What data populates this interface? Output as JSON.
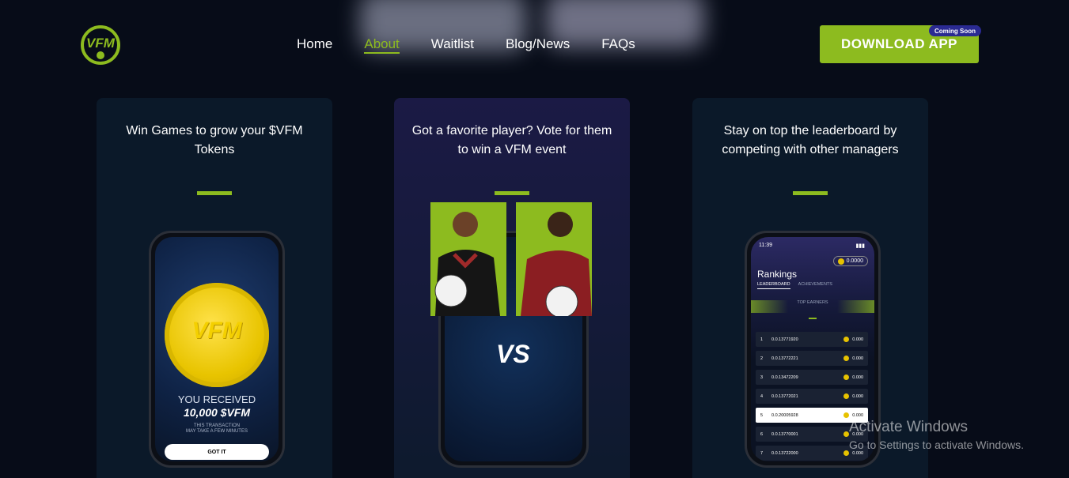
{
  "logo": {
    "alt": "VFM",
    "color": "#8dbb1f"
  },
  "nav": {
    "items": [
      {
        "label": "Home"
      },
      {
        "label": "About"
      },
      {
        "label": "Waitlist"
      },
      {
        "label": "Blog/News"
      },
      {
        "label": "FAQs"
      }
    ],
    "active": "About"
  },
  "download": {
    "label": "DOWNLOAD APP",
    "badge": "Coming Soon"
  },
  "cards": [
    {
      "text": "Win Games to grow your $VFM Tokens"
    },
    {
      "text": "Got a favorite player? Vote for them to win a VFM event"
    },
    {
      "text": "Stay on top the leaderboard by competing with other managers"
    }
  ],
  "phone1": {
    "coin_label": "VFM",
    "received": "YOU RECEIVED",
    "amount": "10,000 $VFM",
    "note_line1": "THIS TRANSACTION",
    "note_line2": "MAY TAKE A FEW MINUTES",
    "button": "GOT IT"
  },
  "phone2": {
    "vs": "VS"
  },
  "phone3": {
    "time": "11:39",
    "balance": "0.0000",
    "title": "Rankings",
    "tab_leaderboard": "LEADERBOARD",
    "tab_achievements": "ACHIEVEMENTS",
    "top_earners": "TOP EARNERS",
    "rows": [
      {
        "rank": "1",
        "addr": "0.0.13771920",
        "value": "0.000"
      },
      {
        "rank": "2",
        "addr": "0.0.13772221",
        "value": "0.000"
      },
      {
        "rank": "3",
        "addr": "0.0.13472209",
        "value": "0.000"
      },
      {
        "rank": "4",
        "addr": "0.0.13772021",
        "value": "0.000"
      },
      {
        "rank": "5",
        "addr": "0.0.20005928",
        "value": "0.000"
      },
      {
        "rank": "6",
        "addr": "0.0.13770001",
        "value": "0.000"
      },
      {
        "rank": "7",
        "addr": "0.0.13722000",
        "value": "0.000"
      }
    ]
  },
  "watermark": {
    "title": "Activate Windows",
    "subtitle": "Go to Settings to activate Windows."
  }
}
